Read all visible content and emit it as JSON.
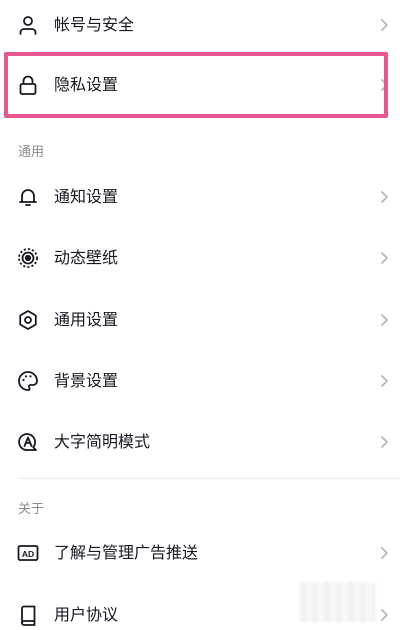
{
  "menu": {
    "account_security": "帐号与安全",
    "privacy_settings": "隐私设置"
  },
  "sections": {
    "general_header": "通用",
    "about_header": "关于"
  },
  "general": {
    "notification_settings": "通知设置",
    "live_wallpaper": "动态壁纸",
    "general_settings": "通用设置",
    "background_settings": "背景设置",
    "large_font_mode": "大字简明模式"
  },
  "about": {
    "ad_management": "了解与管理广告推送",
    "user_agreement": "用户协议"
  },
  "icons": {
    "account": "user-icon",
    "privacy": "lock-icon",
    "notification": "bell-icon",
    "wallpaper": "wallpaper-icon",
    "general": "gear-icon",
    "background": "palette-icon",
    "large_font": "large-font-icon",
    "ad": "ad-icon",
    "agreement": "book-icon",
    "chevron": "chevron-right-icon"
  },
  "colors": {
    "highlight": "#e9558e",
    "text": "#161823",
    "secondary": "#8a8b91",
    "chevron": "#b6b7bc"
  }
}
